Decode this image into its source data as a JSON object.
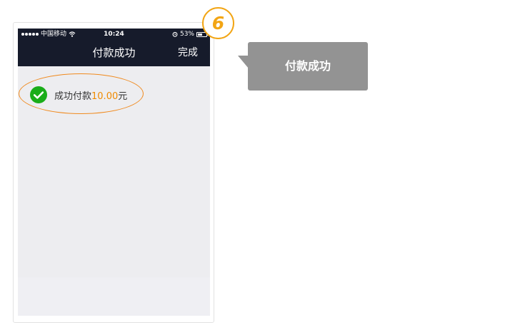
{
  "status_bar": {
    "carrier": "中国移动",
    "time": "10:24",
    "battery_percent": "53%",
    "battery_level": 0.53
  },
  "nav": {
    "title": "付款成功",
    "done_label": "完成"
  },
  "result": {
    "prefix": "成功付款",
    "amount": "10.00",
    "unit": "元"
  },
  "annotation": {
    "step_number": "6",
    "callout_text": "付款成功"
  },
  "colors": {
    "nav_background": "#161b2b",
    "screen_background": "#ededf0",
    "success_green": "#1aad19",
    "amount_orange": "#f08a00",
    "highlight_orange": "#f08a1e",
    "badge_yellow": "#f2a514",
    "callout_gray": "#939393"
  },
  "icons": [
    "signal-dots-icon",
    "wifi-icon",
    "alarm-icon",
    "battery-icon",
    "check-circle-icon"
  ]
}
